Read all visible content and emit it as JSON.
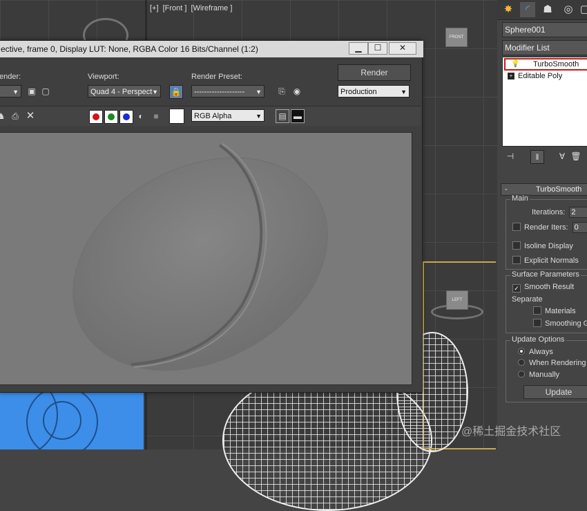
{
  "viewport_label": {
    "parts": [
      "[+]",
      "[Front ]",
      "[Wireframe ]"
    ]
  },
  "viewcube_top": "FRONT",
  "viewcube_persp": "LEFT",
  "command_panel": {
    "object_name": "Sphere001",
    "modifier_list_label": "Modifier List",
    "stack": [
      {
        "label": "TurboSmooth",
        "selected": true
      },
      {
        "label": "Editable Poly",
        "selected": false
      }
    ],
    "rollout_title": "TurboSmooth",
    "main": {
      "title": "Main",
      "iterations_label": "Iterations:",
      "iterations_value": "2",
      "render_iters_label": "Render Iters:",
      "render_iters_value": "0",
      "isoline_label": "Isoline Display",
      "explicit_normals_label": "Explicit Normals"
    },
    "surface": {
      "title": "Surface Parameters",
      "smooth_result_label": "Smooth Result",
      "separate_label": "Separate",
      "materials_label": "Materials",
      "smoothing_label": "Smoothing G"
    },
    "update": {
      "title": "Update Options",
      "always_label": "Always",
      "when_rendering_label": "When Rendering",
      "manually_label": "Manually",
      "update_button": "Update"
    }
  },
  "render_frame": {
    "title": "ective, frame 0, Display LUT: None, RGBA Color 16 Bits/Channel (1:2)",
    "area_label": "ender:",
    "viewport_label": "Viewport:",
    "viewport_value": "Quad 4 - Perspect",
    "preset_label": "Render Preset:",
    "preset_value": "--------------------",
    "render_button": "Render",
    "production_value": "Production",
    "channel_value": "RGB Alpha"
  },
  "watermark": "@稀土掘金技术社区"
}
